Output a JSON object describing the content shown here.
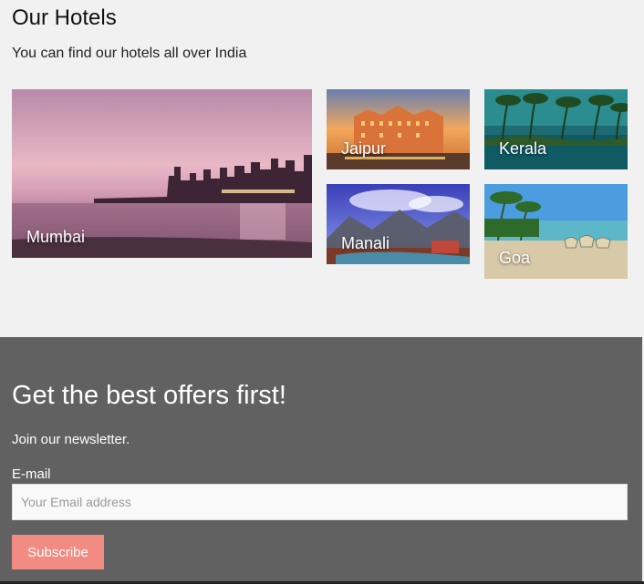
{
  "hotels": {
    "title": "Our Hotels",
    "subtitle": "You can find our hotels all over India",
    "cities": {
      "mumbai": "Mumbai",
      "jaipur": "Jaipur",
      "kerala": "Kerala",
      "manali": "Manali",
      "goa": "Goa"
    }
  },
  "newsletter": {
    "title": "Get the best offers first!",
    "subtitle": "Join our newsletter.",
    "email_label": "E-mail",
    "email_placeholder": "Your Email address",
    "email_value": "",
    "subscribe_label": "Subscribe"
  },
  "colors": {
    "newsletter_bg": "#616161",
    "button_bg": "#f28b82",
    "page_bg": "#f1f1f1"
  }
}
